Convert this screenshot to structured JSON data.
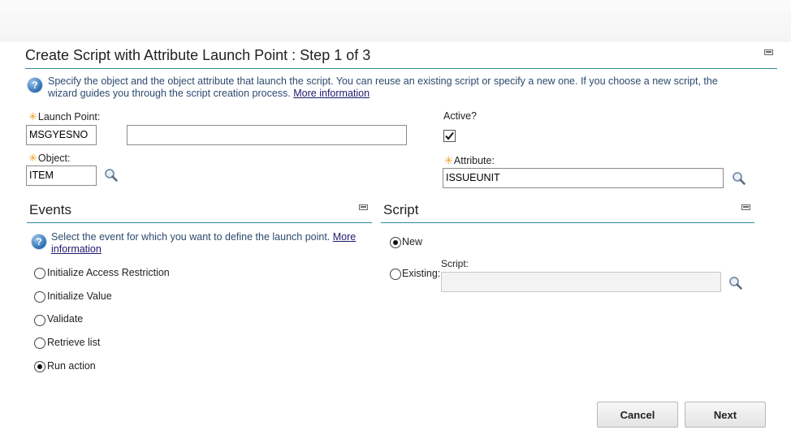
{
  "dialog": {
    "title": "Create Script with Attribute Launch Point : Step 1 of 3",
    "help_text": "Specify the object and the object attribute that launch the script. You can reuse an existing script or specify a new one. If you choose a new script, the",
    "help_text_line2": "wizard guides you through the script creation process.",
    "help_link": "More information"
  },
  "form": {
    "launch_point_label": "Launch Point:",
    "launch_point_value": "MSGYESNO",
    "launch_point_description": "",
    "object_label": "Object:",
    "object_value": "ITEM",
    "active_label": "Active?",
    "active_checked": true,
    "attribute_label": "Attribute:",
    "attribute_value": "ISSUEUNIT"
  },
  "events": {
    "title": "Events",
    "help_text": "Select the event for which you want to define the launch point.",
    "help_link_part1": "More",
    "help_link_part2": "information",
    "options": [
      {
        "label": "Initialize Access Restriction",
        "selected": false
      },
      {
        "label": "Initialize Value",
        "selected": false
      },
      {
        "label": "Validate",
        "selected": false
      },
      {
        "label": "Retrieve list",
        "selected": false
      },
      {
        "label": "Run action",
        "selected": true
      }
    ]
  },
  "script": {
    "title": "Script",
    "new_label": "New",
    "new_selected": true,
    "existing_label": "Existing:",
    "existing_selected": false,
    "script_field_label": "Script:",
    "script_field_value": ""
  },
  "buttons": {
    "cancel": "Cancel",
    "next": "Next"
  },
  "icons": {
    "help": "help-icon",
    "lookup": "magnifier-icon",
    "minimize": "minimize-icon",
    "required": "required-asterisk-icon"
  },
  "colors": {
    "accent_rule": "#2f8a94",
    "help_text": "#2d4a6e",
    "required": "#f0a020"
  }
}
